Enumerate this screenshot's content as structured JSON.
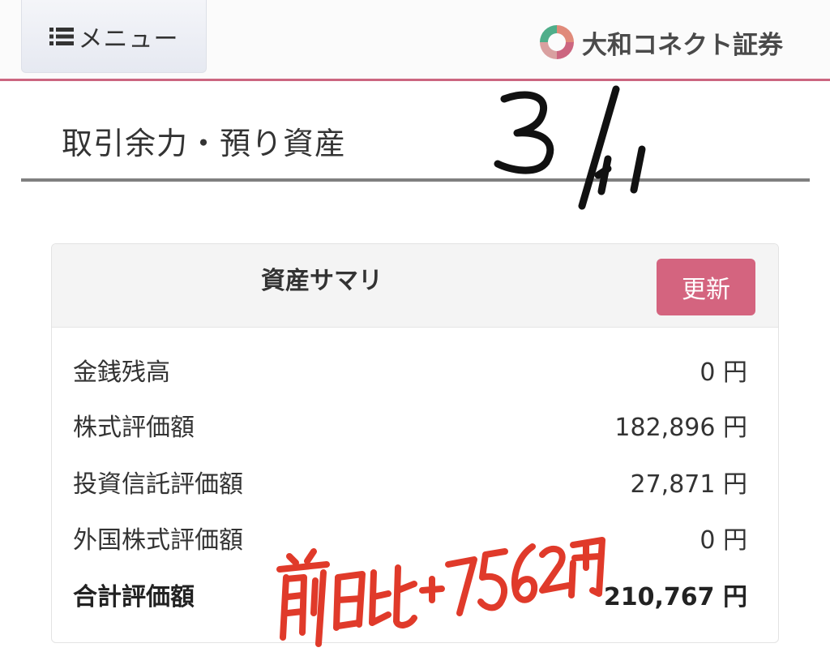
{
  "header": {
    "menu_label": "メニュー",
    "menu_icon": "list-icon",
    "brand_name": "大和コネクト証券",
    "brand_logo_icon": "daiwa-connect-logo",
    "accent_color": "#cc6680"
  },
  "page": {
    "title": "取引余力・預り資産"
  },
  "handwriting": {
    "date": "3/11",
    "note": "前日比+7562円",
    "date_color": "#111111",
    "note_color": "#e03a2a"
  },
  "summary": {
    "title": "資産サマリ",
    "refresh_label": "更新",
    "refresh_color": "#d4647f",
    "rows": [
      {
        "label": "金銭残高",
        "value": "0 円"
      },
      {
        "label": "株式評価額",
        "value": "182,896 円"
      },
      {
        "label": "投資信託評価額",
        "value": "27,871 円"
      },
      {
        "label": "外国株式評価額",
        "value": "0 円"
      }
    ],
    "total": {
      "label": "合計評価額",
      "value": "210,767 円"
    }
  }
}
